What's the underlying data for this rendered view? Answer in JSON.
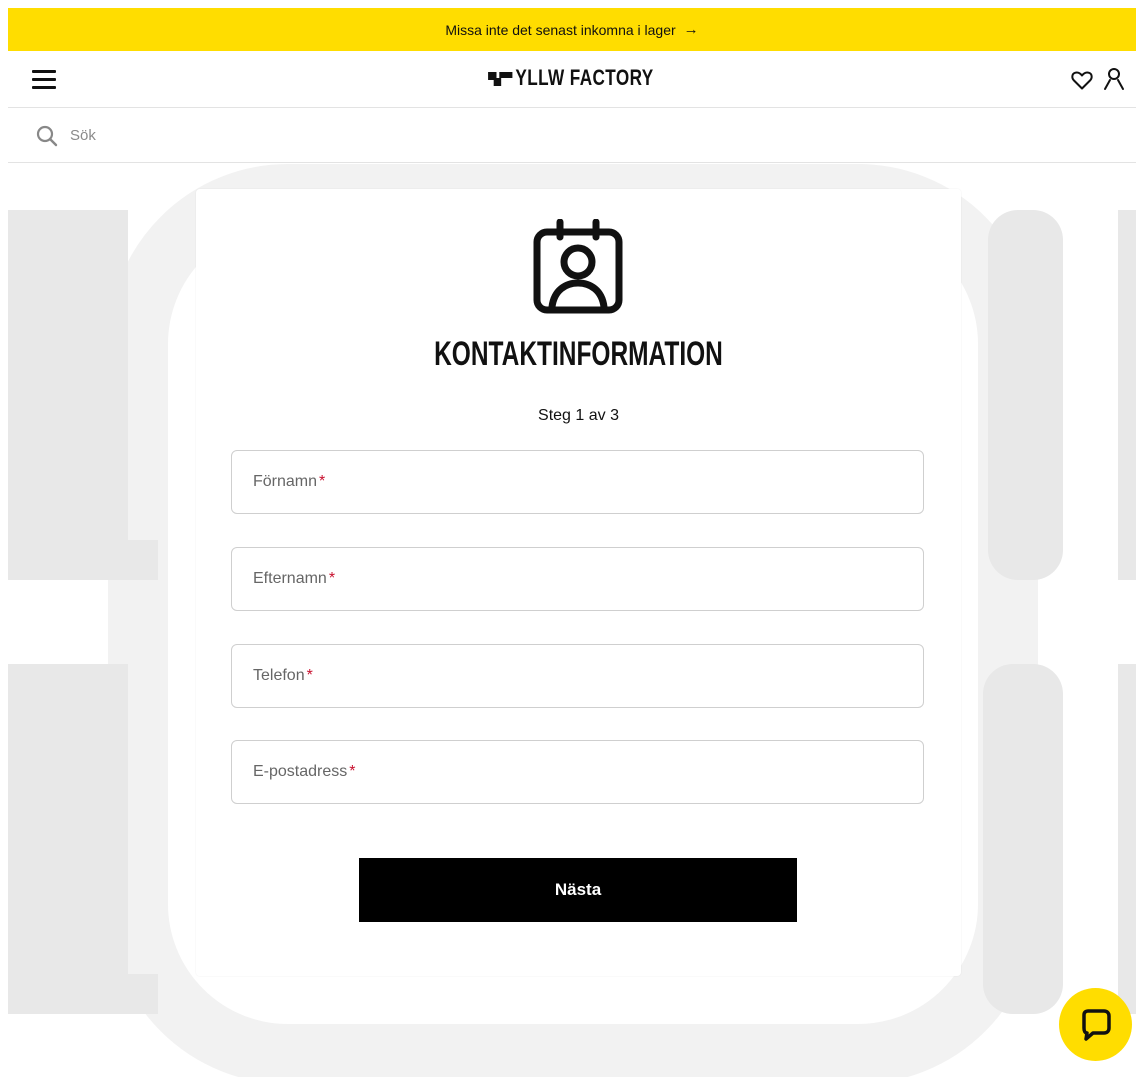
{
  "announcement": {
    "text": "Missa inte det senast inkomna i lager",
    "arrow": "→"
  },
  "header": {
    "logo_text": "YLLW FACTORY",
    "menu_icon": "hamburger-menu-icon",
    "wishlist_icon": "heart-icon",
    "account_icon": "user-icon"
  },
  "search": {
    "placeholder": "Sök",
    "icon": "search-icon"
  },
  "form": {
    "icon": "contact-card-icon",
    "title": "KONTAKTINFORMATION",
    "step": "Steg 1 av 3",
    "fields": [
      {
        "label": "Förnamn",
        "required": "*"
      },
      {
        "label": "Efternamn",
        "required": "*"
      },
      {
        "label": "Telefon",
        "required": "*"
      },
      {
        "label": "E-postadress",
        "required": "*"
      }
    ],
    "next_label": "Nästa"
  },
  "chat": {
    "icon": "chat-bubble-icon"
  },
  "colors": {
    "brand_yellow": "#ffdd00",
    "button": "#000000",
    "required": "#c8102e"
  }
}
